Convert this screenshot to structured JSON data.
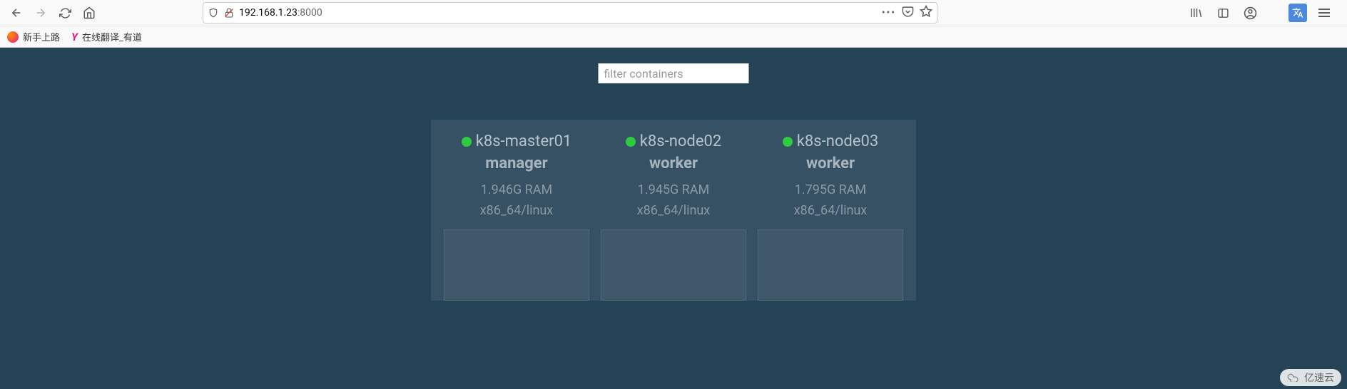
{
  "browser": {
    "url_host": "192.168.1.23",
    "url_port": ":8000",
    "bookmarks": [
      {
        "label": "新手上路",
        "icon": "firefox"
      },
      {
        "label": "在线翻译_有道",
        "icon": "y"
      }
    ]
  },
  "page": {
    "filter_placeholder": "filter containers",
    "nodes": [
      {
        "name": "k8s-master01",
        "role": "manager",
        "ram": "1.946G RAM",
        "arch": "x86_64/linux",
        "status": "up"
      },
      {
        "name": "k8s-node02",
        "role": "worker",
        "ram": "1.945G RAM",
        "arch": "x86_64/linux",
        "status": "up"
      },
      {
        "name": "k8s-node03",
        "role": "worker",
        "ram": "1.795G RAM",
        "arch": "x86_64/linux",
        "status": "up"
      }
    ]
  },
  "watermark": {
    "text": "亿速云"
  }
}
